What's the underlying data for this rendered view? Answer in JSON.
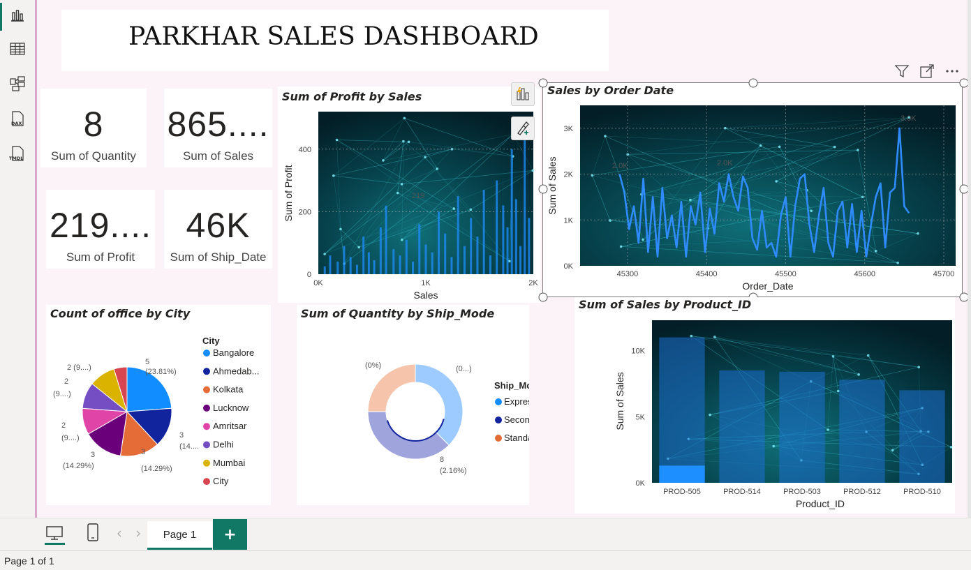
{
  "dashboard": {
    "title": "PARKHAR SALES DASHBOARD"
  },
  "kpis": [
    {
      "value": "8",
      "label": "Sum of Quantity"
    },
    {
      "value": "865....",
      "label": "Sum of Sales"
    },
    {
      "value": "219....",
      "label": "Sum of Profit"
    },
    {
      "value": "46K",
      "label": "Sum of Ship_Date"
    }
  ],
  "left_rail": {
    "icons": [
      "report-view-icon",
      "table-view-icon",
      "model-view-icon",
      "dax-query-icon",
      "tmdl-view-icon"
    ],
    "dax_label": "DAX",
    "tmdl_label": "TMDL"
  },
  "colors": {
    "accent": "#117865",
    "bar_blue": "#1e8fff",
    "line_blue": "#2f8cff"
  },
  "chart_data": [
    {
      "type": "bar",
      "title": "Sum of Profit by Sales",
      "xlabel": "Sales",
      "ylabel": "Sum of Profit",
      "x_ticks": [
        "0K",
        "1K",
        "2K"
      ],
      "y_ticks": [
        "0",
        "200",
        "400"
      ],
      "xlim": [
        0,
        2000
      ],
      "ylim": [
        0,
        520
      ],
      "annotations": [
        "219"
      ],
      "x": [
        60,
        110,
        180,
        240,
        300,
        360,
        420,
        470,
        520,
        580,
        630,
        700,
        760,
        820,
        880,
        940,
        1000,
        1060,
        1120,
        1180,
        1240,
        1300,
        1360,
        1420,
        1480,
        1540,
        1600,
        1660,
        1720,
        1760,
        1800,
        1840,
        1880,
        1920,
        1960
      ],
      "values": [
        25,
        60,
        40,
        90,
        55,
        30,
        120,
        70,
        45,
        150,
        219,
        80,
        60,
        110,
        40,
        160,
        95,
        70,
        200,
        130,
        55,
        250,
        90,
        180,
        120,
        270,
        60,
        300,
        220,
        150,
        400,
        240,
        90,
        430,
        180
      ]
    },
    {
      "type": "line",
      "title": "Sales by Order Date",
      "xlabel": "Order_Date",
      "ylabel": "Sum of Sales",
      "x_ticks": [
        "45300",
        "45400",
        "45500",
        "45600",
        "45700"
      ],
      "y_ticks": [
        "0K",
        "1K",
        "2K",
        "3K"
      ],
      "xlim": [
        45240,
        45715
      ],
      "ylim": [
        0,
        3500
      ],
      "annotations": [
        "2.0K",
        "2.0K",
        "3.0K"
      ],
      "x": [
        45290,
        45296,
        45302,
        45308,
        45314,
        45320,
        45326,
        45332,
        45338,
        45344,
        45350,
        45356,
        45362,
        45368,
        45374,
        45380,
        45386,
        45392,
        45398,
        45404,
        45410,
        45416,
        45422,
        45428,
        45434,
        45440,
        45446,
        45452,
        45458,
        45464,
        45470,
        45476,
        45482,
        45488,
        45494,
        45500,
        45506,
        45512,
        45518,
        45524,
        45530,
        45536,
        45542,
        45548,
        45554,
        45560,
        45566,
        45572,
        45578,
        45584,
        45590,
        45596,
        45602,
        45608,
        45614,
        45620,
        45626,
        45632,
        45638,
        45644,
        45650,
        45656
      ],
      "values": [
        2000,
        1600,
        800,
        1300,
        500,
        1900,
        300,
        1500,
        200,
        1700,
        600,
        1100,
        400,
        1400,
        200,
        1300,
        900,
        1600,
        300,
        1250,
        700,
        1800,
        1400,
        2000,
        1500,
        1200,
        1950,
        1700,
        600,
        350,
        1200,
        400,
        500,
        200,
        1100,
        1500,
        200,
        1300,
        1900,
        2000,
        900,
        300,
        1100,
        1700,
        500,
        200,
        1200,
        1400,
        400,
        1350,
        300,
        1200,
        200,
        900,
        1500,
        1800,
        400,
        1600,
        1700,
        3000,
        1300,
        1150
      ]
    },
    {
      "type": "pie",
      "title": "Count of office by City",
      "legend_title": "City",
      "categories": [
        "Bangalore",
        "Ahmedab...",
        "Kolkata",
        "Lucknow",
        "Amritsar",
        "Delhi",
        "Mumbai",
        "City"
      ],
      "values": [
        5,
        3,
        3,
        3,
        2,
        2,
        2,
        1
      ],
      "colors": [
        "#118dff",
        "#12239e",
        "#e66c37",
        "#6b007b",
        "#e044a7",
        "#744ec2",
        "#d9b300",
        "#d64550"
      ],
      "labels": [
        {
          "line1": "5",
          "line2": "(23.81%)"
        },
        {
          "line1": "3",
          "line2": "(14...."
        },
        {
          "line1": "3",
          "line2": "(14.29%)"
        },
        {
          "line1": "3",
          "line2": "(14.29%)"
        },
        {
          "line1": "2",
          "line2": "(9....)"
        },
        {
          "line1": "2",
          "line2": "(9....)"
        },
        {
          "line1": "2 (9....)",
          "line2": ""
        }
      ]
    },
    {
      "type": "pie",
      "subtype": "donut",
      "title": "Sum of Quantity by Ship_Mode",
      "legend_title": "Ship_Mode",
      "categories": [
        "Express",
        "Second Cl...",
        "Standard"
      ],
      "values": [
        3,
        3,
        2
      ],
      "colors": [
        "#9ecbff",
        "#9fa4dc",
        "#f5c4ab"
      ],
      "legend_colors": [
        "#118dff",
        "#12239e",
        "#e66c37"
      ],
      "labels": [
        {
          "line1": "(0...)",
          "line2": ""
        },
        {
          "line1": "8",
          "line2": "(2.16%)"
        },
        {
          "line1": "(0%)",
          "line2": ""
        }
      ]
    },
    {
      "type": "bar",
      "title": "Sum of Sales by Product_ID",
      "xlabel": "Product_ID",
      "ylabel": "Sum of Sales",
      "categories": [
        "PROD-505",
        "PROD-514",
        "PROD-503",
        "PROD-512",
        "PROD-510"
      ],
      "values": [
        11000,
        8500,
        8400,
        7800,
        7000
      ],
      "y_ticks": [
        "0K",
        "5K",
        "10K"
      ],
      "ylim": [
        0,
        12300
      ]
    }
  ],
  "tabs": {
    "page1": "Page 1",
    "add": "+"
  },
  "status": {
    "text": "Page 1 of 1"
  }
}
